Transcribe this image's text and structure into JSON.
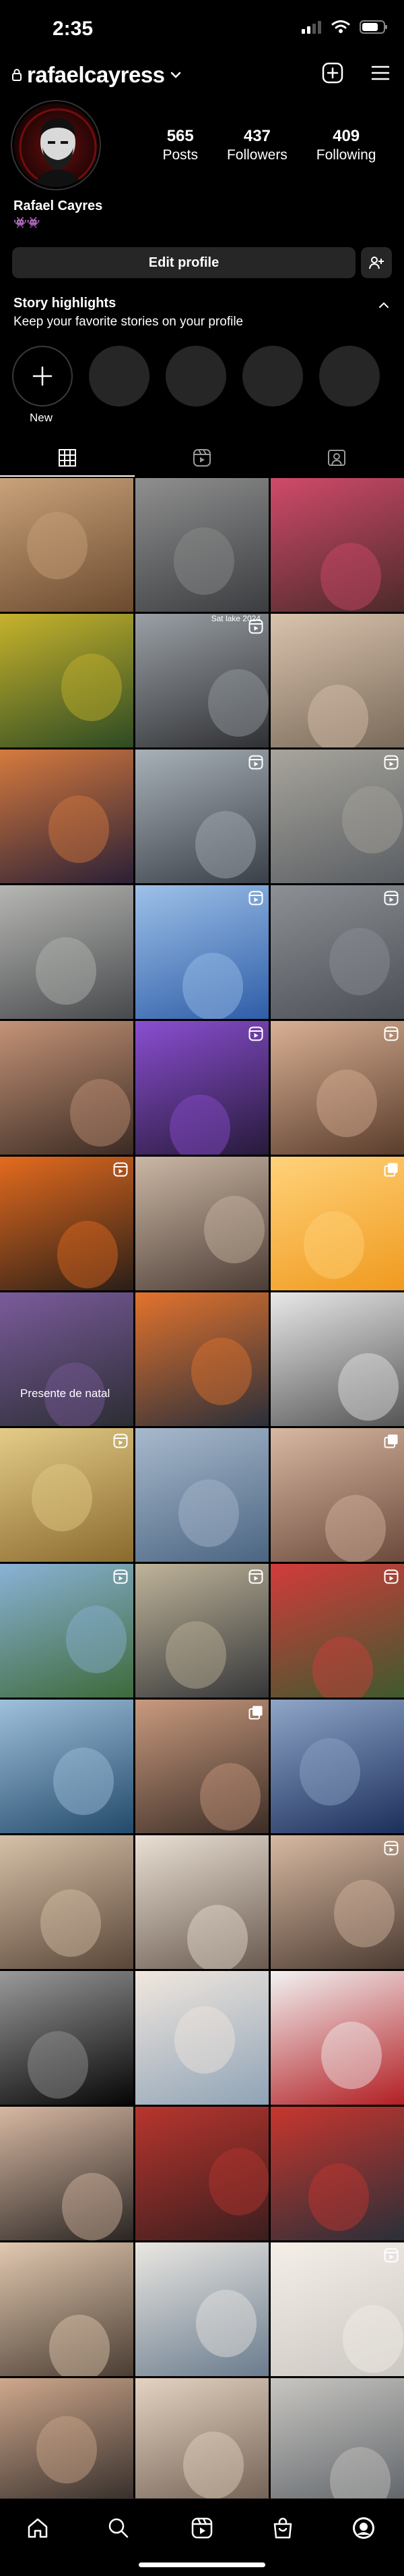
{
  "status_bar": {
    "time": "2:35"
  },
  "header": {
    "username": "rafaelcayress"
  },
  "profile": {
    "full_name": "Rafael Cayres",
    "bio_line": "👾👾",
    "stats": [
      {
        "num": "565",
        "label": "Posts"
      },
      {
        "num": "437",
        "label": "Followers"
      },
      {
        "num": "409",
        "label": "Following"
      }
    ],
    "edit_label": "Edit profile"
  },
  "highlights": {
    "title": "Story highlights",
    "subtitle": "Keep your favorite stories on your profile",
    "new_label": "New"
  },
  "grid": {
    "overlay_text_1": "Sat lake 2024",
    "overlay_text_2": "Presente de natal",
    "items": [
      {
        "badge": "",
        "colors": [
          "#6b4a2e",
          "#c9a27a"
        ]
      },
      {
        "badge": "",
        "colors": [
          "#3b3d40",
          "#8f8f8f"
        ]
      },
      {
        "badge": "",
        "colors": [
          "#4c2a2a",
          "#d04a6a"
        ]
      },
      {
        "badge": "",
        "colors": [
          "#2d4a23",
          "#c7b32c"
        ]
      },
      {
        "badge": "reel",
        "colors": [
          "#2f3033",
          "#9aa0a6"
        ]
      },
      {
        "badge": "",
        "colors": [
          "#7a6a5a",
          "#d9c3ad"
        ]
      },
      {
        "badge": "",
        "colors": [
          "#2a2036",
          "#d67a3e"
        ]
      },
      {
        "badge": "reel",
        "colors": [
          "#3a4048",
          "#a8b0b8"
        ]
      },
      {
        "badge": "reel",
        "colors": [
          "#5a5e63",
          "#a8a59c"
        ]
      },
      {
        "badge": "",
        "colors": [
          "#47494c",
          "#b6b7b3"
        ]
      },
      {
        "badge": "reel",
        "colors": [
          "#2e5da8",
          "#9ec1e8"
        ]
      },
      {
        "badge": "reel",
        "colors": [
          "#4b4f55",
          "#8d9196"
        ]
      },
      {
        "badge": "",
        "colors": [
          "#3a2a22",
          "#c49377"
        ]
      },
      {
        "badge": "reel",
        "colors": [
          "#271a3a",
          "#8a4ed1"
        ]
      },
      {
        "badge": "reel",
        "colors": [
          "#5a3d2c",
          "#d9b094"
        ]
      },
      {
        "badge": "reel",
        "colors": [
          "#2a1e17",
          "#e46b1e"
        ]
      },
      {
        "badge": "",
        "colors": [
          "#4c3d35",
          "#cbb7a5"
        ]
      },
      {
        "badge": "carousel",
        "colors": [
          "#f09a1e",
          "#ffd27a"
        ]
      },
      {
        "badge": "",
        "colors": [
          "#2b2d33",
          "#7b5b9c"
        ]
      },
      {
        "badge": "",
        "colors": [
          "#2a2f3a",
          "#e3732d"
        ]
      },
      {
        "badge": "",
        "colors": [
          "#555",
          "#e8e8e8"
        ]
      },
      {
        "badge": "reel",
        "colors": [
          "#8a6a2e",
          "#e4cc88"
        ]
      },
      {
        "badge": "",
        "colors": [
          "#4b6582",
          "#a8b9cc"
        ]
      },
      {
        "badge": "carousel",
        "colors": [
          "#6b4a3c",
          "#d8b8a1"
        ]
      },
      {
        "badge": "reel",
        "colors": [
          "#3e6a3a",
          "#8ab2d6"
        ]
      },
      {
        "badge": "reel",
        "colors": [
          "#363739",
          "#bfb49a"
        ]
      },
      {
        "badge": "reel",
        "colors": [
          "#3e5a2e",
          "#d33b3b"
        ]
      },
      {
        "badge": "",
        "colors": [
          "#234a6b",
          "#9fc0db"
        ]
      },
      {
        "badge": "carousel",
        "colors": [
          "#3b2d26",
          "#c99a7e"
        ]
      },
      {
        "badge": "",
        "colors": [
          "#1c2f5c",
          "#8fa6c8"
        ]
      },
      {
        "badge": "",
        "colors": [
          "#5a4638",
          "#d6c1a8"
        ]
      },
      {
        "badge": "",
        "colors": [
          "#6a5a50",
          "#eae0d4"
        ]
      },
      {
        "badge": "reel",
        "colors": [
          "#4c3b32",
          "#d7b9a1"
        ]
      },
      {
        "badge": "",
        "colors": [
          "#050505",
          "#9a9a9a"
        ]
      },
      {
        "badge": "",
        "colors": [
          "#8fa3b6",
          "#f1e7de"
        ]
      },
      {
        "badge": "",
        "colors": [
          "#b21f24",
          "#f2f2f2"
        ]
      },
      {
        "badge": "",
        "colors": [
          "#2a2523",
          "#d7b8a2"
        ]
      },
      {
        "badge": "",
        "colors": [
          "#3a1e1e",
          "#b8352e"
        ]
      },
      {
        "badge": "",
        "colors": [
          "#2a2f38",
          "#c8362e"
        ]
      },
      {
        "badge": "",
        "colors": [
          "#4a3d33",
          "#e2c9b0"
        ]
      },
      {
        "badge": "",
        "colors": [
          "#6a7c8e",
          "#eae7e2"
        ]
      },
      {
        "badge": "reel",
        "colors": [
          "#cbc7c2",
          "#f5efe8"
        ]
      },
      {
        "badge": "",
        "colors": [
          "#2c2725",
          "#cfa88c"
        ]
      },
      {
        "badge": "",
        "colors": [
          "#6d5b4e",
          "#e4d2c2"
        ]
      },
      {
        "badge": "",
        "colors": [
          "#5b6066",
          "#c8c6c1"
        ]
      }
    ]
  }
}
